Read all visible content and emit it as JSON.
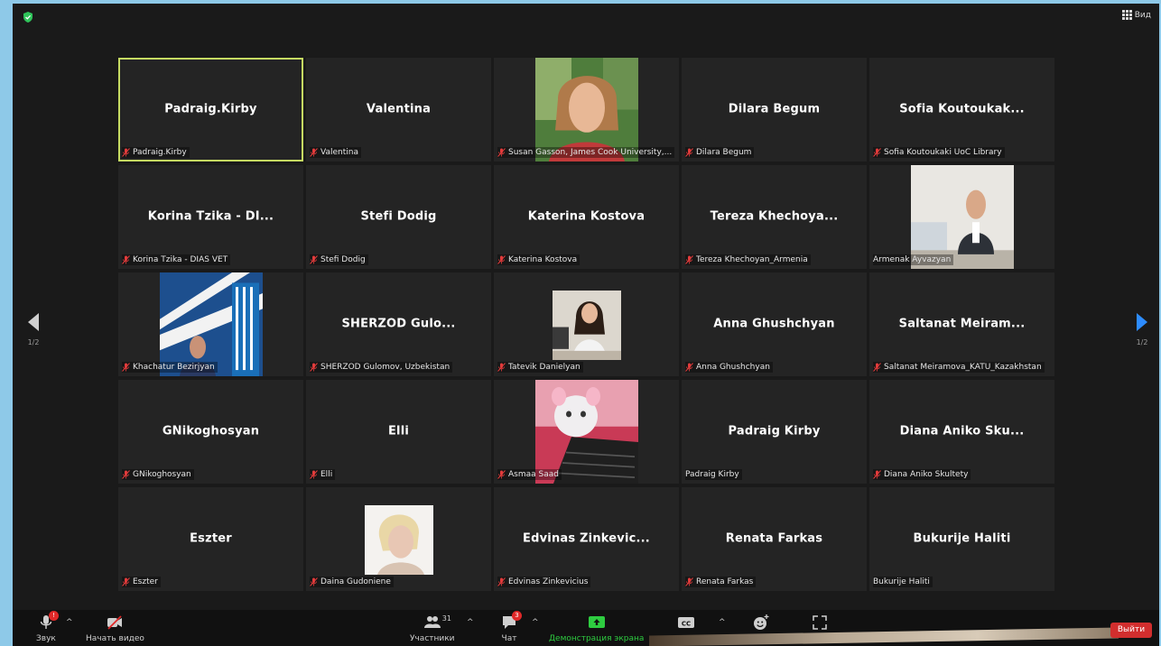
{
  "header": {
    "view_label": "Вид"
  },
  "pager": {
    "left_text": "1/2",
    "right_text": "1/2"
  },
  "tiles": [
    {
      "big": "Padraig.Kirby",
      "label": "Padraig.Kirby",
      "muted": true,
      "active": true
    },
    {
      "big": "Valentina",
      "label": "Valentina",
      "muted": true
    },
    {
      "big": "",
      "label": "Susan Gasson, James Cook University,...",
      "muted": true,
      "photo": "portrait-woman-outdoor"
    },
    {
      "big": "Dilara Begum",
      "label": "Dilara Begum",
      "muted": true
    },
    {
      "big": "Sofia  Koutoukak...",
      "label": "Sofia Koutoukaki UoC Library",
      "muted": true
    },
    {
      "big": "Korina  Tzika - DI...",
      "label": "Korina Tzika - DIAS VET",
      "muted": true
    },
    {
      "big": "Stefi Dodig",
      "label": "Stefi Dodig",
      "muted": true
    },
    {
      "big": "Katerina Kostova",
      "label": "Katerina Kostova",
      "muted": true
    },
    {
      "big": "Tereza  Khechoya...",
      "label": "Tereza Khechoyan_Armenia",
      "muted": true
    },
    {
      "big": "",
      "label": "Armenak Ayvazyan",
      "muted": false,
      "photo": "man-at-desk"
    },
    {
      "big": "",
      "label": "Khachatur Bezirjyan",
      "muted": true,
      "photo": "man-with-logo"
    },
    {
      "big": "SHERZOD  Gulo...",
      "label": "SHERZOD Gulomov, Uzbekistan",
      "muted": true
    },
    {
      "big": "",
      "label": "Tatevik Danielyan",
      "muted": true,
      "photo": "woman-at-desk",
      "small": true
    },
    {
      "big": "Anna Ghushchyan",
      "label": "Anna Ghushchyan",
      "muted": true
    },
    {
      "big": "Saltanat  Meiram...",
      "label": "Saltanat Meiramova_KATU_Kazakhstan",
      "muted": true
    },
    {
      "big": "GNikoghosyan",
      "label": "GNikoghosyan",
      "muted": true
    },
    {
      "big": "Elli",
      "label": "Elli",
      "muted": true
    },
    {
      "big": "",
      "label": "Asmaa Saad",
      "muted": true,
      "photo": "toy-keyboard"
    },
    {
      "big": "Padraig Kirby",
      "label": "Padraig Kirby",
      "muted": false
    },
    {
      "big": "Diana  Aniko  Sku...",
      "label": "Diana Aniko Skultety",
      "muted": true
    },
    {
      "big": "Eszter",
      "label": "Eszter",
      "muted": true
    },
    {
      "big": "",
      "label": "Daina Gudoniene",
      "muted": true,
      "photo": "blonde-woman",
      "small": true
    },
    {
      "big": "Edvinas  Zinkevic...",
      "label": "Edvinas Zinkevicius",
      "muted": true
    },
    {
      "big": "Renata Farkas",
      "label": "Renata Farkas",
      "muted": true
    },
    {
      "big": "Bukurije Haliti",
      "label": "Bukurije Haliti",
      "muted": false
    }
  ],
  "toolbar": {
    "audio_label": "Звук",
    "audio_badge": "!",
    "video_label": "Начать видео",
    "participants_label": "Участники",
    "participants_count": "31",
    "chat_label": "Чат",
    "chat_badge": "3",
    "share_label": "Демонстрация экрана",
    "cc_label": "CC",
    "leave_label": "Выйти"
  },
  "colors": {
    "active_border": "#c6db62",
    "share_green": "#2ecc40",
    "leave_red": "#d22e2e",
    "accent_blue": "#2d8cff"
  }
}
